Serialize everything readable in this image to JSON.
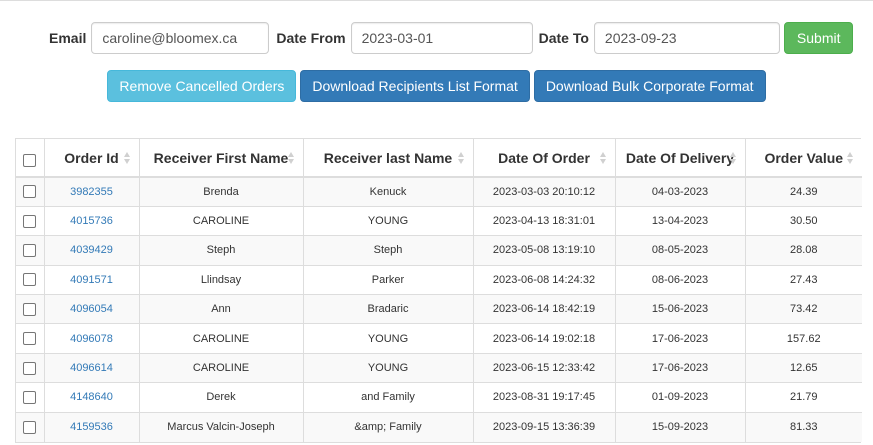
{
  "filters": {
    "email_label": "Email",
    "email_value": "caroline@bloomex.ca",
    "date_from_label": "Date From",
    "date_from_value": "2023-03-01",
    "date_to_label": "Date To",
    "date_to_value": "2023-09-23",
    "submit_label": "Submit"
  },
  "actions": {
    "remove_cancelled": "Remove Cancelled Orders",
    "download_recipients": "Download Recipients List Format",
    "download_bulk": "Download Bulk Corporate Format"
  },
  "table": {
    "headers": [
      "Order Id",
      "Receiver First Name",
      "Receiver last Name",
      "Date Of Order",
      "Date Of Delivery",
      "Order Value"
    ],
    "rows": [
      [
        "3982355",
        "Brenda",
        "Kenuck",
        "2023-03-03 20:10:12",
        "04-03-2023",
        "24.39"
      ],
      [
        "4015736",
        "CAROLINE",
        "YOUNG",
        "2023-04-13 18:31:01",
        "13-04-2023",
        "30.50"
      ],
      [
        "4039429",
        "Steph",
        "Steph",
        "2023-05-08 13:19:10",
        "08-05-2023",
        "28.08"
      ],
      [
        "4091571",
        "Llindsay",
        "Parker",
        "2023-06-08 14:24:32",
        "08-06-2023",
        "27.43"
      ],
      [
        "4096054",
        "Ann",
        "Bradaric",
        "2023-06-14 18:42:19",
        "15-06-2023",
        "73.42"
      ],
      [
        "4096078",
        "CAROLINE",
        "YOUNG",
        "2023-06-14 19:02:18",
        "17-06-2023",
        "157.62"
      ],
      [
        "4096614",
        "CAROLINE",
        "YOUNG",
        "2023-06-15 12:33:42",
        "17-06-2023",
        "12.65"
      ],
      [
        "4148640",
        "Derek",
        "and Family",
        "2023-08-31 19:17:45",
        "01-09-2023",
        "21.79"
      ],
      [
        "4159536",
        "Marcus Valcin-Joseph",
        "&amp; Family",
        "2023-09-15 13:36:39",
        "15-09-2023",
        "81.33"
      ]
    ]
  },
  "colors": {
    "success": "#5cb85c",
    "info": "#5bc0de",
    "primary": "#337ab7",
    "link": "#337ab7"
  }
}
